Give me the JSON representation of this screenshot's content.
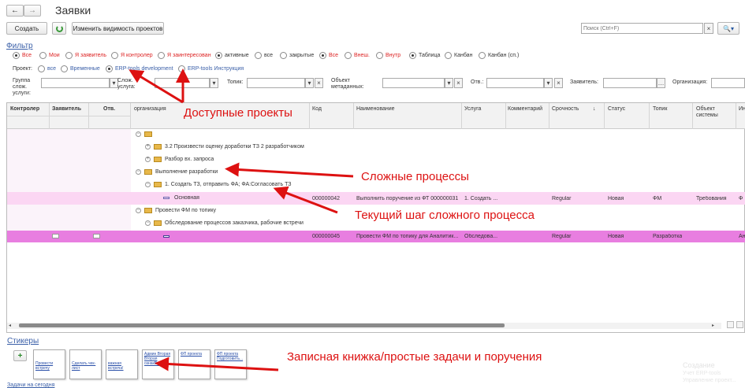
{
  "nav": {
    "back": "←",
    "forward": "→"
  },
  "title": "Заявки",
  "toolbar": {
    "create": "Создать",
    "visibility": "Изменить видимость проектов",
    "search_placeholder": "Поиск (Ctrl+F)",
    "search_clear": "×"
  },
  "filter": {
    "title": "Фильтр",
    "row1": [
      "Все",
      "Мои",
      "Я заявитель",
      "Я контролер",
      "Я заинтересован",
      "активные",
      "все",
      "закрытые",
      "Все",
      "Внеш.",
      "Внутр",
      "Таблица",
      "Канбан",
      "Канбан (сп.)"
    ],
    "project_label": "Проект:",
    "projects": [
      "все",
      "Временные",
      "ERP-tools development",
      "ERP-tools Инструкция"
    ],
    "group_label": "Группа слож. услуги:",
    "service_label": "Слож. услуга:",
    "topic_label": "Топик:",
    "object_label": "Объект метаданных:",
    "resp_label": "Отв.:",
    "applicant_label": "Заявитель:",
    "org_label": "Организация:"
  },
  "table": {
    "headers": [
      "Контролер",
      "Заявитель",
      "Отв.",
      "организация",
      "Код",
      "Наименование",
      "Услуга",
      "Комментарий",
      "Срочность",
      "Статус",
      "Топик",
      "Объект системы",
      "Ин"
    ],
    "sort_arrow": "↓",
    "tree": [
      "",
      "3.2 Произвести оценку доработки ТЗ 2 разработчиком",
      "Разбор вх. запроса",
      "Выполнение разработки",
      "1. Создать ТЗ, отправить ФА; ФА:Согласовать ТЗ",
      "Основная",
      "Провести ФМ по топику",
      "Обследование процессов заказчика, рабочие встречи"
    ],
    "row1": {
      "code": "000000042",
      "name": "Выполнить поручение из ФТ 000000031",
      "service": "1. Создать ...",
      "urgency": "Regular",
      "status": "Новая",
      "topic": "ФМ",
      "object": "Требования",
      "extra": "Ф"
    },
    "row2": {
      "code": "000000045",
      "name": "Провести ФМ по топику для Аналитик...",
      "service": "Обследова...",
      "urgency": "Regular",
      "status": "Новая",
      "topic": "Разработка",
      "extra": "Ан"
    }
  },
  "annotations": {
    "projects": "Доступные проекты",
    "complex": "Сложные процессы",
    "step": "Текущий шаг сложного процесса",
    "notes": "Записная книжка/простые задачи и поручения"
  },
  "stickers": {
    "title": "Стикеры",
    "add": "+",
    "items": [
      "Провести встречу",
      "Сделать чек-лист",
      "важная встреча!",
      "Админ Вторая Вторая ознакВтор...",
      "ФП проекта",
      "ФП проекта Подготовить..."
    ],
    "today": "Задачи на сегодня"
  },
  "watermark": [
    "Создание",
    "Учет ERP-tools",
    "Управление проект..."
  ],
  "colors": {
    "accent": "#d11",
    "highlight": "#fbd6f3",
    "selected": "#e87ee0"
  }
}
